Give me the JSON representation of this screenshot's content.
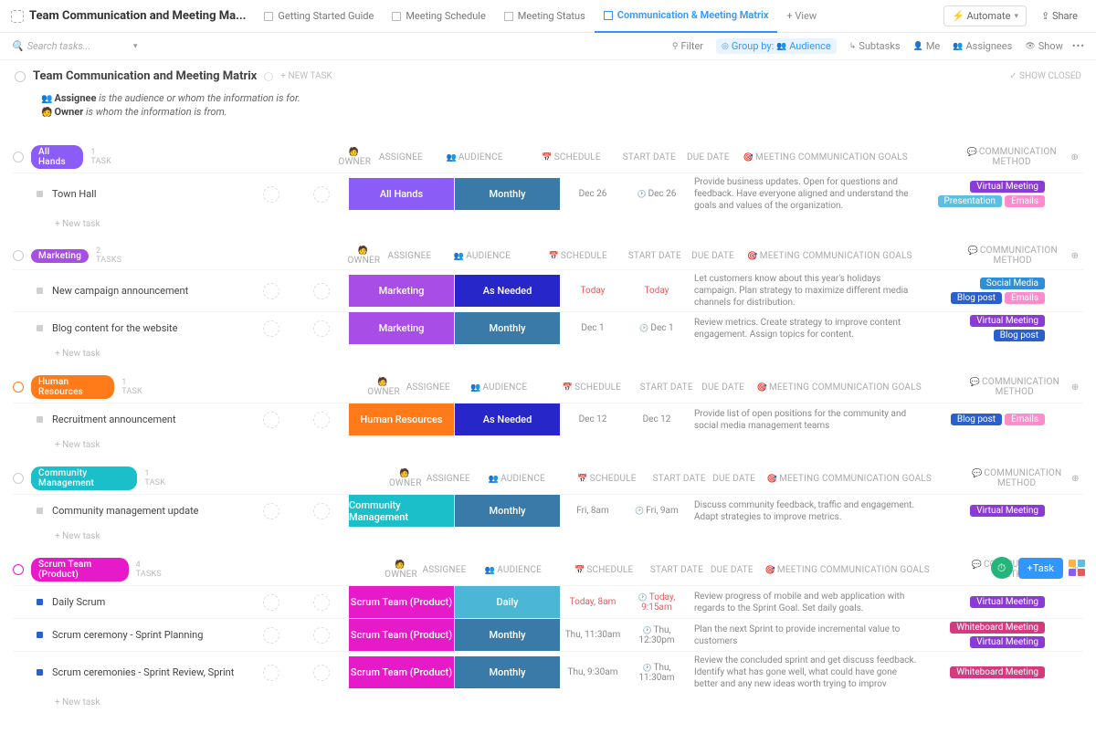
{
  "top": {
    "title": "Team Communication and Meeting Ma...",
    "tabs": [
      {
        "label": "Getting Started Guide",
        "active": false
      },
      {
        "label": "Meeting Schedule",
        "active": false
      },
      {
        "label": "Meeting Status",
        "active": false
      },
      {
        "label": "Communication & Meeting Matrix",
        "active": true
      }
    ],
    "add_view": "+ View",
    "automate": "Automate",
    "share": "Share"
  },
  "filter": {
    "search_placeholder": "Search tasks...",
    "filter": "Filter",
    "group_by": "Group by:",
    "group_val": "Audience",
    "subtasks": "Subtasks",
    "me": "Me",
    "assignees": "Assignees",
    "show": "Show"
  },
  "header": {
    "title": "Team Communication and Meeting Matrix",
    "new_task": "+ NEW TASK",
    "show_closed": "✓ SHOW CLOSED"
  },
  "legend": {
    "line1_label": "Assignee",
    "line1_text": " is the audience or whom the information is for.",
    "line2_label": "Owner",
    "line2_text": " is whom the information is from."
  },
  "cols": {
    "owner": "OWNER",
    "assignee": "ASSIGNEE",
    "audience": "AUDIENCE",
    "schedule": "SCHEDULE",
    "start": "START DATE",
    "due": "DUE DATE",
    "goals": "MEETING COMMUNICATION GOALS",
    "method": "COMMUNICATION METHOD"
  },
  "newtask": "+ New task",
  "colors": {
    "virtual_meeting": "#8b3ad6",
    "presentation": "#5abfe0",
    "emails": "#ff8bcc",
    "social_media": "#2e8fd6",
    "blog_post": "#2b5fcd",
    "whiteboard": "#d63a7e",
    "sched": "#3a7aa8",
    "sched_daily": "#4cb6d6"
  },
  "groups": [
    {
      "name": "All Hands",
      "badge_color": "#8b5cf6",
      "count": "1 TASK",
      "circ": "#ccc",
      "rows": [
        {
          "name": "Town Hall",
          "sq": "#cfcfcf",
          "audience": "All Hands",
          "aud_color": "#8b5cf6",
          "schedule": "Monthly",
          "sch_color": "#3a7aa8",
          "start": "Dec 26",
          "due": "Dec 26",
          "due_clock": true,
          "goals": "Provide business updates. Open for questions and feedback. Have everyone aligned and understand the goals and values of the organization.",
          "methods": [
            {
              "label": "Virtual Meeting",
              "color": "#8b3ad6"
            },
            {
              "label": "Presentation",
              "color": "#5abfe0"
            },
            {
              "label": "Emails",
              "color": "#ff8bcc"
            }
          ]
        }
      ]
    },
    {
      "name": "Marketing",
      "badge_color": "#a84de6",
      "count": "2 TASKS",
      "circ": "#ccc",
      "rows": [
        {
          "name": "New campaign announcement",
          "sq": "#cfcfcf",
          "audience": "Marketing",
          "aud_color": "#a84de6",
          "schedule": "As Needed",
          "sch_color": "#2626c9",
          "start": "Today",
          "start_today": true,
          "due": "Today",
          "due_today": true,
          "goals": "Let customers know about this year's holidays campaign. Plan strategy to maximize different media channels for distribution.",
          "methods": [
            {
              "label": "Social Media",
              "color": "#2e8fd6"
            },
            {
              "label": "Blog post",
              "color": "#2b5fcd"
            },
            {
              "label": "Emails",
              "color": "#ff8bcc"
            }
          ]
        },
        {
          "name": "Blog content for the website",
          "sq": "#cfcfcf",
          "audience": "Marketing",
          "aud_color": "#a84de6",
          "schedule": "Monthly",
          "sch_color": "#3a7aa8",
          "start": "Dec 1",
          "due": "Dec 1",
          "due_clock": true,
          "goals": "Review metrics. Create strategy to improve content engagement. Assign topics for content.",
          "methods": [
            {
              "label": "Virtual Meeting",
              "color": "#8b3ad6"
            },
            {
              "label": "Blog post",
              "color": "#2b5fcd"
            }
          ]
        }
      ]
    },
    {
      "name": "Human Resources",
      "badge_color": "#ff7b1a",
      "count": "1 TASK",
      "circ": "#ff7b1a",
      "rows": [
        {
          "name": "Recruitment announcement",
          "sq": "#cfcfcf",
          "audience": "Human Resources",
          "aud_color": "#ff7b1a",
          "schedule": "As Needed",
          "sch_color": "#2626c9",
          "start": "Dec 12",
          "due": "Dec 12",
          "goals": "Provide list of open positions for the community and social media management teams",
          "methods": [
            {
              "label": "Blog post",
              "color": "#2b5fcd"
            },
            {
              "label": "Emails",
              "color": "#ff8bcc"
            }
          ]
        }
      ]
    },
    {
      "name": "Community Management",
      "badge_color": "#1abfc9",
      "count": "1 TASK",
      "circ": "#ccc",
      "rows": [
        {
          "name": "Community management update",
          "sq": "#cfcfcf",
          "audience": "Community Management",
          "aud_color": "#1abfc9",
          "schedule": "Monthly",
          "sch_color": "#3a7aa8",
          "start": "Fri, 8am",
          "due": "Fri, 9am",
          "due_clock": true,
          "goals": "Discuss community feedback, traffic and engagement. Adapt strategies to improve metrics.",
          "methods": [
            {
              "label": "Virtual Meeting",
              "color": "#8b3ad6"
            }
          ]
        }
      ]
    },
    {
      "name": "Scrum Team (Product)",
      "badge_color": "#e61ac9",
      "count": "4 TASKS",
      "circ": "#e61ac9",
      "rows": [
        {
          "name": "Daily Scrum",
          "sq": "#2b5fcd",
          "audience": "Scrum Team (Product)",
          "aud_color": "#e61ac9",
          "schedule": "Daily",
          "sch_color": "#4cb6d6",
          "start": "Today, 8am",
          "start_today": true,
          "due": "Today, 9:15am",
          "due_today": true,
          "due_clock": true,
          "goals": "Review progress of mobile and web application with regards to the Sprint Goal. Set daily goals.",
          "methods": [
            {
              "label": "Virtual Meeting",
              "color": "#8b3ad6"
            }
          ]
        },
        {
          "name": "Scrum ceremony - Sprint Planning",
          "sq": "#2b5fcd",
          "audience": "Scrum Team (Product)",
          "aud_color": "#e61ac9",
          "schedule": "Monthly",
          "sch_color": "#3a7aa8",
          "start": "Thu, 11:30am",
          "due": "Thu, 12:30pm",
          "due_clock": true,
          "goals": "Plan the next Sprint to provide incremental value to customers",
          "methods": [
            {
              "label": "Whiteboard Meeting",
              "color": "#d63a7e"
            },
            {
              "label": "Virtual Meeting",
              "color": "#8b3ad6"
            }
          ]
        },
        {
          "name": "Scrum ceremonies - Sprint Review, Sprint",
          "sq": "#2b5fcd",
          "audience": "Scrum Team (Product)",
          "aud_color": "#e61ac9",
          "schedule": "Monthly",
          "sch_color": "#3a7aa8",
          "start": "Thu, 9:30am",
          "due": "Thu, 11:30am",
          "due_clock": true,
          "goals": "Review the concluded sprint and get discuss feedback. Identify what has gone well, what could have gone better and any new ideas worth trying to improv",
          "methods": [
            {
              "label": "Whiteboard Meeting",
              "color": "#d63a7e"
            }
          ]
        }
      ]
    }
  ],
  "float": {
    "task": "Task"
  }
}
